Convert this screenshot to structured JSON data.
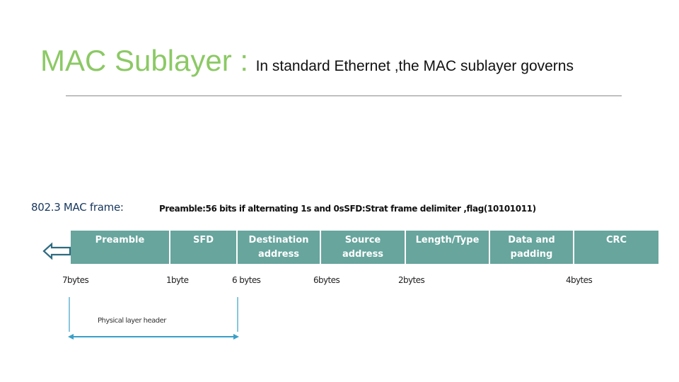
{
  "header": {
    "title": "MAC Sublayer :",
    "subtitle": "In standard Ethernet ,the MAC sublayer governs"
  },
  "frame_section": {
    "label": "802.3 MAC frame:",
    "description": "Preamble:56 bits if alternating 1s and 0sSFD:Strat frame delimiter ,flag(10101011)"
  },
  "frame_fields": [
    {
      "label_line1": "Preamble",
      "label_line2": "",
      "size": "7bytes"
    },
    {
      "label_line1": "SFD",
      "label_line2": "",
      "size": "1byte"
    },
    {
      "label_line1": "Destination",
      "label_line2": "address",
      "size": "6 bytes"
    },
    {
      "label_line1": "Source",
      "label_line2": "address",
      "size": "6bytes"
    },
    {
      "label_line1": "Length/Type",
      "label_line2": "",
      "size": "2bytes"
    },
    {
      "label_line1": "Data and",
      "label_line2": "padding",
      "size": ""
    },
    {
      "label_line1": "CRC",
      "label_line2": "",
      "size": "4bytes"
    }
  ],
  "physical_header": {
    "label": "Physical layer header"
  },
  "colors": {
    "title": "#8cc965",
    "frame_label": "#17375e",
    "cell_fill": "#67a59d",
    "arrow": "#2e6b80",
    "bracket": "#3aa0c8"
  }
}
